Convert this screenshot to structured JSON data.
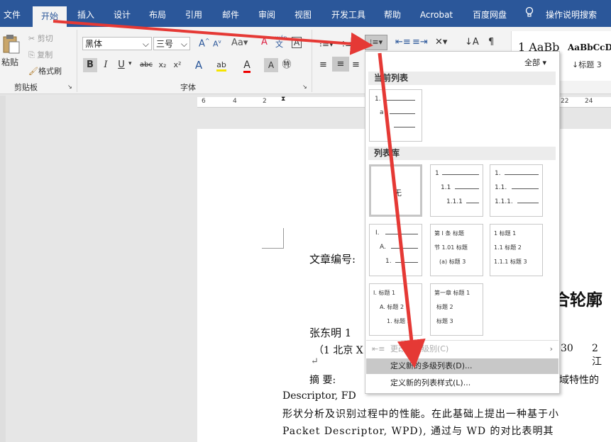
{
  "tabs": [
    "文件",
    "开始",
    "插入",
    "设计",
    "布局",
    "引用",
    "邮件",
    "审阅",
    "视图",
    "开发工具",
    "帮助",
    "Acrobat",
    "百度网盘"
  ],
  "active_tab": "开始",
  "tell_me": "操作说明搜索",
  "clipboard": {
    "paste": "粘贴",
    "cut": "剪切",
    "copy": "复制",
    "format_painter": "格式刷",
    "group": "剪贴板"
  },
  "font": {
    "name": "黑体",
    "size": "三号",
    "group": "字体",
    "grow": "A",
    "clear": "A",
    "wen": "wén",
    "bold": "B",
    "italic": "I",
    "underline": "U",
    "strike": "abc",
    "sub": "x₂",
    "sup": "x²"
  },
  "styles": {
    "sample1": "1 AaBb",
    "sample2": "AaBbCcDd",
    "heading3": "↓标题 3"
  },
  "ruler_numbers": [
    "6",
    "4",
    "2",
    "22",
    "24"
  ],
  "dropdown": {
    "filter": "全部",
    "current_list": "当前列表",
    "current_thumb": [
      "1.",
      "a",
      "."
    ],
    "library": "列表库",
    "none": "无",
    "thumbs": [
      [
        "1",
        "1.1",
        "1.1.1"
      ],
      [
        "1.",
        "1.1.",
        "1.1.1."
      ],
      [
        "I.",
        "A.",
        "1."
      ],
      [
        "第 I 条 标题",
        "节 1.01 标题",
        "(a) 标题 3"
      ],
      [
        "1 标题 1",
        "1.1 标题 2",
        "1.1.1 标题 3"
      ],
      [
        "I. 标题 1",
        "A. 标题 2",
        "1. 标题 3"
      ],
      [
        "第一章 标题 1",
        "标题 2",
        "标题 3"
      ]
    ],
    "change_level": "更改列表级别(C)",
    "define_multilevel": "定义新的多级列表(D)...",
    "define_style": "定义新的列表样式(L)..."
  },
  "doc": {
    "article_no": "文章编号:",
    "title_frag": "合轮廓",
    "author": "张东明 1",
    "affil": "（1 北京 X",
    "affil_num": "30",
    "affil_num2": "2 江",
    "enter": "↵",
    "abstract_label": "摘    要:",
    "abstract_tail": "域特性的",
    "line2": "Descriptor, FD              ",
    "line3": "形状分析及识别过程中的性能。在此基础上提出一种基于小",
    "line4": "Packet Descriptor, WPD), 通过与 WD 的对比表明其"
  }
}
